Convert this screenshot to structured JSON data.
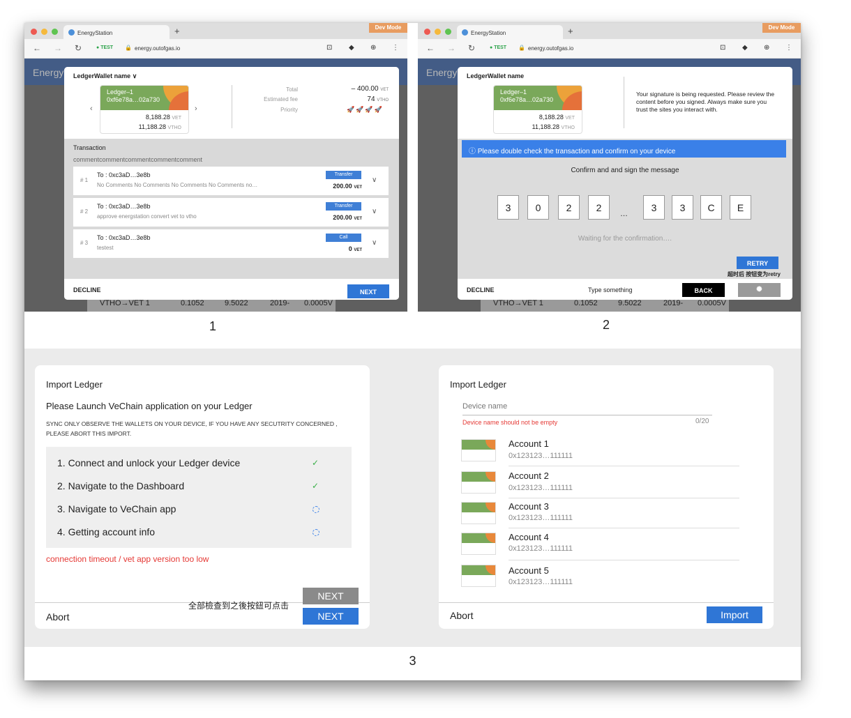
{
  "browser": {
    "tab_title": "EnergyStation",
    "dev_mode": "Dev Mode",
    "test_tag": "TEST",
    "url": "energy.outofgas.io",
    "app_title": "EnergyStation"
  },
  "window1": {
    "wallet_name": "LedgerWallet name",
    "card": {
      "name": "Ledger–1",
      "address": "0xf6e78a…02a730",
      "vet": "8,188.28",
      "vet_unit": "VET",
      "vtho": "11,188.28",
      "vtho_unit": "VTHO"
    },
    "fees": {
      "total_label": "Total",
      "total_value": "– 400.00",
      "total_unit": "VET",
      "fee_label": "Estimated fee",
      "fee_value": "74",
      "fee_unit": "VTHO",
      "priority_label": "Priority"
    },
    "transaction_label": "Transaction",
    "comment": "commentcommentcommentcommentcomment",
    "txs": [
      {
        "num": "# 1",
        "to": "To : 0xc3aD…3e8b",
        "desc": "No Comments No Comments No Comments No Comments no…",
        "type": "Transfer",
        "amount": "200.00",
        "unit": "VET"
      },
      {
        "num": "# 2",
        "to": "To : 0xc3aD…3e8b",
        "desc": "approve energstation convert vet to vtho",
        "type": "Transfer",
        "amount": "200.00",
        "unit": "VET"
      },
      {
        "num": "# 3",
        "to": "To : 0xc3aD…3e8b",
        "desc": "testest",
        "type": "Call",
        "amount": "0",
        "unit": "VET"
      }
    ],
    "decline": "DECLINE",
    "next": "NEXT",
    "bg_row": [
      "VTHO→VET 1",
      "0.1052",
      "9.5022",
      "2019-",
      "0.0005V"
    ],
    "caption": "1"
  },
  "window2": {
    "wallet_name": "LedgerWallet name",
    "card": {
      "name": "Ledger–1",
      "address": "0xf6e78a…02a730",
      "vet": "8,188.28",
      "vet_unit": "VET",
      "vtho": "11,188.28",
      "vtho_unit": "VTHO"
    },
    "signature_msg": "Your signature is being requested. Please review the content before you signed. Always make sure you trust the sites you interact with.",
    "info": "Please double check the transaction and confirm on your device",
    "confirm_title": "Confirm and and sign the message",
    "code": [
      "3",
      "0",
      "2",
      "2",
      "3",
      "3",
      "C",
      "E"
    ],
    "ellipsis": "…",
    "waiting": "Waiting for the confirmation….",
    "retry": "RETRY",
    "retry_note": "超时后 按钮变为retry",
    "decline": "DECLINE",
    "type_something": "Type something",
    "back": "BACK",
    "caption": "2"
  },
  "panel_left": {
    "title": "Import Ledger",
    "subtitle": "Please Launch VeChain application on your Ledger",
    "notice": "SYNC ONLY  OBSERVE THE WALLETS ON YOUR DEVICE, IF YOU HAVE ANY SECUTRITY CONCERNED , PLEASE ABORT THIS IMPORT.",
    "steps": [
      "1. Connect and unlock your Ledger device",
      "2. Navigate to the Dashboard",
      "3. Navigate  to VeChain app",
      "4. Getting account info"
    ],
    "error": "connection timeout / vet app version too low",
    "abort": "Abort",
    "next_disabled": "NEXT",
    "next": "NEXT",
    "note": "全部檢查到之後按鈕可点击"
  },
  "panel_right": {
    "title": "Import Ledger",
    "placeholder": "Device name",
    "error": "Device name should not be empty",
    "counter": "0/20",
    "accounts": [
      {
        "name": "Account 1",
        "addr": "0x123123…111111"
      },
      {
        "name": "Account 2",
        "addr": "0x123123…111111"
      },
      {
        "name": "Account 3",
        "addr": "0x123123…111111"
      },
      {
        "name": "Account 4",
        "addr": "0x123123…111111"
      },
      {
        "name": "Account 5",
        "addr": "0x123123…111111"
      }
    ],
    "abort": "Abort",
    "import": "Import"
  },
  "caption3": "3",
  "colors": {
    "accent": "#3a80e8",
    "brand": "#2d5aa6",
    "error": "#e53935",
    "success": "#3bb04a",
    "dev": "#e89c60"
  }
}
